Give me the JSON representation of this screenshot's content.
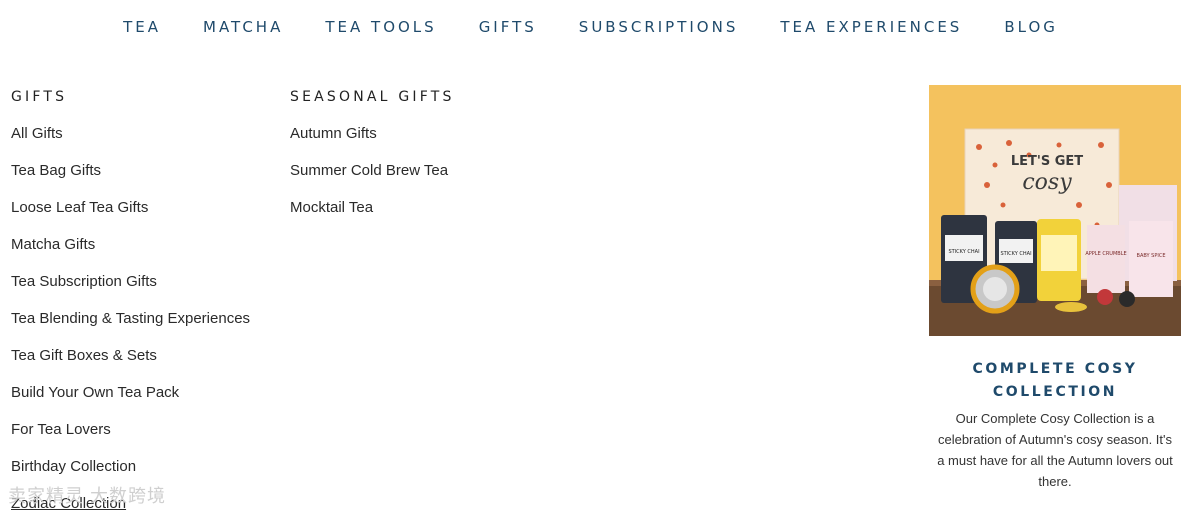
{
  "nav": {
    "items": [
      "TEA",
      "MATCHA",
      "TEA TOOLS",
      "GIFTS",
      "SUBSCRIPTIONS",
      "TEA EXPERIENCES",
      "BLOG"
    ]
  },
  "gifts_column": {
    "title": "GIFTS",
    "links": [
      "All Gifts",
      "Tea Bag Gifts",
      "Loose Leaf Tea Gifts",
      "Matcha Gifts",
      "Tea Subscription Gifts",
      "Tea Blending & Tasting Experiences",
      "Tea Gift Boxes & Sets",
      "Build Your Own Tea Pack",
      "For Tea Lovers",
      "Birthday Collection",
      "Zodiac Collection"
    ]
  },
  "seasonal_column": {
    "title": "SEASONAL GIFTS",
    "links": [
      "Autumn Gifts",
      "Summer Cold Brew Tea",
      "Mocktail Tea"
    ]
  },
  "promo": {
    "title_line1": "COMPLETE COSY",
    "title_line2": "COLLECTION",
    "description": "Our Complete Cosy Collection is a celebration of Autumn's cosy season. It's a must have for all the Autumn lovers out there.",
    "box_text_line1": "LET'S GET",
    "box_text_line2": "cosy",
    "tin_labels": [
      "STICKY CHAI",
      "STICKY CHAI",
      "",
      "APPLE CRUMBLE",
      "BABY SPICE"
    ]
  },
  "watermark": "卖家精灵 大数跨境"
}
